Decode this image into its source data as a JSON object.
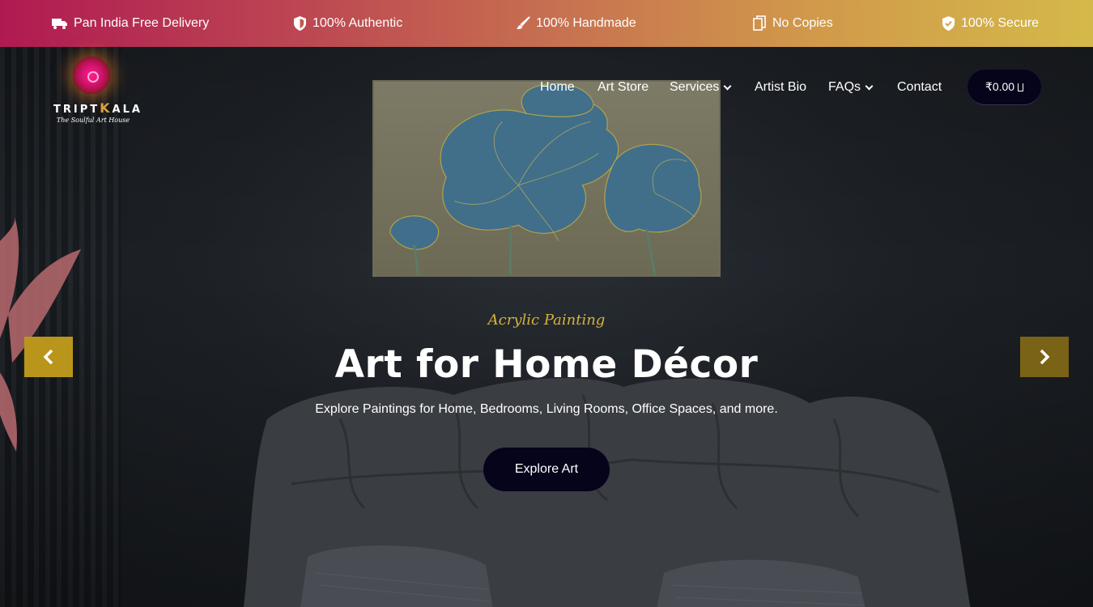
{
  "topbar": {
    "items": [
      {
        "label": "Pan India Free Delivery",
        "icon": "truck-icon"
      },
      {
        "label": "100% Authentic",
        "icon": "shield-icon"
      },
      {
        "label": "100% Handmade",
        "icon": "brush-icon"
      },
      {
        "label": "No Copies",
        "icon": "copy-icon"
      },
      {
        "label": "100% Secure",
        "icon": "shield-check-icon"
      }
    ]
  },
  "brand": {
    "name_prefix": "TRIPT",
    "name_k": "K",
    "name_suffix": "ALA",
    "tagline": "The Soulful Art House"
  },
  "nav": {
    "items": [
      {
        "label": "Home",
        "has_dropdown": false
      },
      {
        "label": "Art Store",
        "has_dropdown": false
      },
      {
        "label": "Services",
        "has_dropdown": true
      },
      {
        "label": "Artist Bio",
        "has_dropdown": false
      },
      {
        "label": "FAQs",
        "has_dropdown": true
      },
      {
        "label": "Contact",
        "has_dropdown": false
      }
    ],
    "cart_label": "₹0.00"
  },
  "hero": {
    "eyebrow": "Acrylic Painting",
    "title": "Art for Home Décor",
    "subtitle": "Explore Paintings for Home, Bedrooms, Living Rooms, Office Spaces, and more.",
    "cta_label": "Explore Art"
  },
  "colors": {
    "accent_gold": "#d6b23c",
    "arrow_bg": "#b9951c",
    "button_bg": "#05041a",
    "topbar_start": "#b01a52",
    "topbar_end": "#d4b94a"
  }
}
